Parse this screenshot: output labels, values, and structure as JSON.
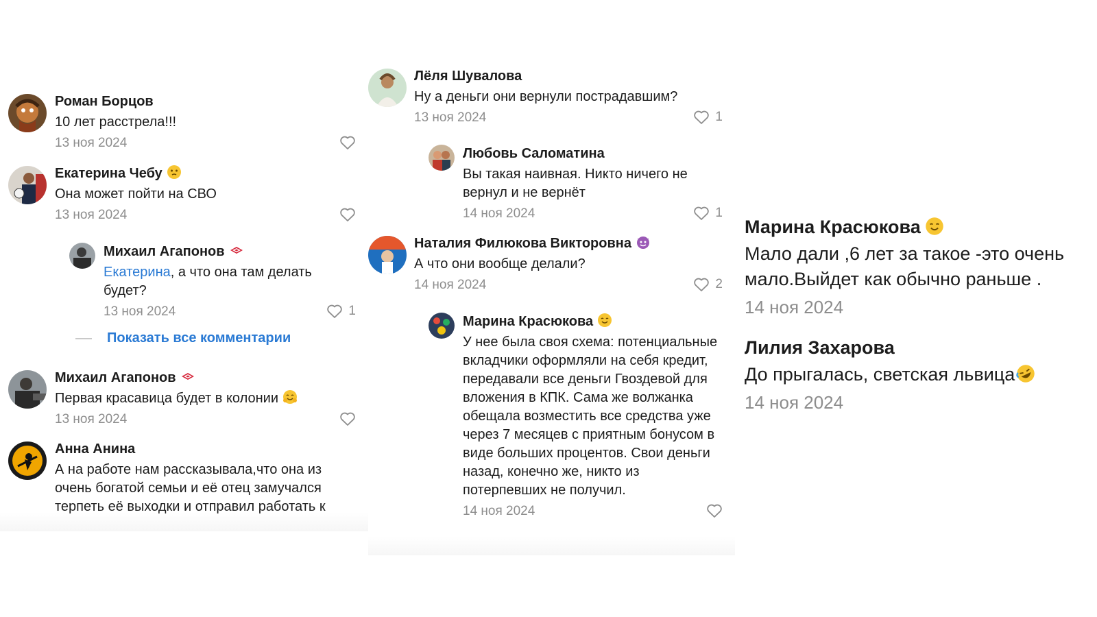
{
  "left": {
    "comments": [
      {
        "author": "Роман Борцов",
        "text": "10 лет расстрела!!!",
        "date": "13 ноя 2024",
        "likes": ""
      },
      {
        "author": "Екатерина Чебу",
        "text": "Она может пойти на СВО",
        "date": "13 ноя 2024",
        "likes": ""
      },
      {
        "author": "Михаил Агапонов",
        "mention": "Екатерина",
        "text": ", а что она там делать будет?",
        "date": "13 ноя 2024",
        "likes": "1"
      },
      {
        "author": "Михаил Агапонов",
        "text": "Первая красавица будет в колонии",
        "date": "13 ноя 2024",
        "likes": ""
      },
      {
        "author": "Анна Анина",
        "text": "А на работе нам рассказывала,что она из очень богатой семьи и её отец замучался терпеть её выходки и отправил работать к"
      }
    ],
    "show_all_label": "Показать все комментарии"
  },
  "middle": {
    "comments": [
      {
        "author": "Лёля Шувалова",
        "text": "Ну а деньги они вернули пострадавшим?",
        "date": "13 ноя 2024",
        "likes": "1"
      },
      {
        "author": "Любовь Саломатина",
        "text": "Вы такая наивная. Никто ничего не вернул и не вернёт",
        "date": "14 ноя 2024",
        "likes": "1"
      },
      {
        "author": "Наталия Филюкова Викторовна",
        "text": "А что они вообще делали?",
        "date": "14 ноя 2024",
        "likes": "2"
      },
      {
        "author": "Марина Красюкова",
        "text": "У нее была своя схема: потенциальные вкладчики оформляли на себя кредит, передавали все деньги Гвоздевой для вложения в КПК. Сама же волжанка обещала возместить все средства уже через 7 месяцев с приятным бонусом в виде больших процентов. Свои деньги назад, конечно же, никто из потерпевших не получил.",
        "date": "14 ноя 2024"
      }
    ]
  },
  "right": {
    "comments": [
      {
        "author": "Марина Красюкова",
        "text": "Мало дали ,6 лет за такое -это очень мало.Выйдет как обычно раньше .",
        "date": "14 ноя 2024"
      },
      {
        "author": "Лилия Захарова",
        "text": "До прыгалась, светская львица",
        "date": "14 ноя 2024"
      }
    ]
  },
  "colors": {
    "link": "#2a7ad4",
    "meta": "#8d8d8d",
    "text": "#1c1c1c"
  },
  "icons": [
    "heart-outline-icon",
    "emoji-face-icon",
    "spartak-logo-icon",
    "laughing-emoji-icon"
  ]
}
